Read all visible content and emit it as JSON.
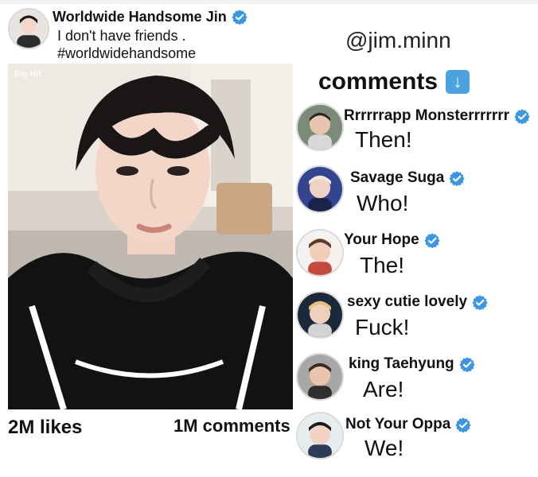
{
  "post": {
    "author": "Worldwide Handsome Jin",
    "caption_line1": "I don't have friends .",
    "caption_line2": "#worldwidehandsome",
    "photo_watermark": "Big Hit",
    "likes": "2M likes",
    "comments_count": "1M comments"
  },
  "handle": "@jim.minn",
  "comments_title": "comments",
  "comments_icon": "down-arrow-icon",
  "colors": {
    "verified_badge": "#3b97e3",
    "down_arrow_bg": "#4aa3df"
  },
  "comments": [
    {
      "name": "Rrrrrrapp Monsterrrrrrr",
      "text": "Then!"
    },
    {
      "name": "Savage Suga",
      "text": "Who!"
    },
    {
      "name": "Your Hope",
      "text": "The!"
    },
    {
      "name": "sexy cutie lovely",
      "text": "Fuck!"
    },
    {
      "name": "king Taehyung",
      "text": "Are!"
    },
    {
      "name": "Not Your Oppa",
      "text": "We!"
    }
  ]
}
